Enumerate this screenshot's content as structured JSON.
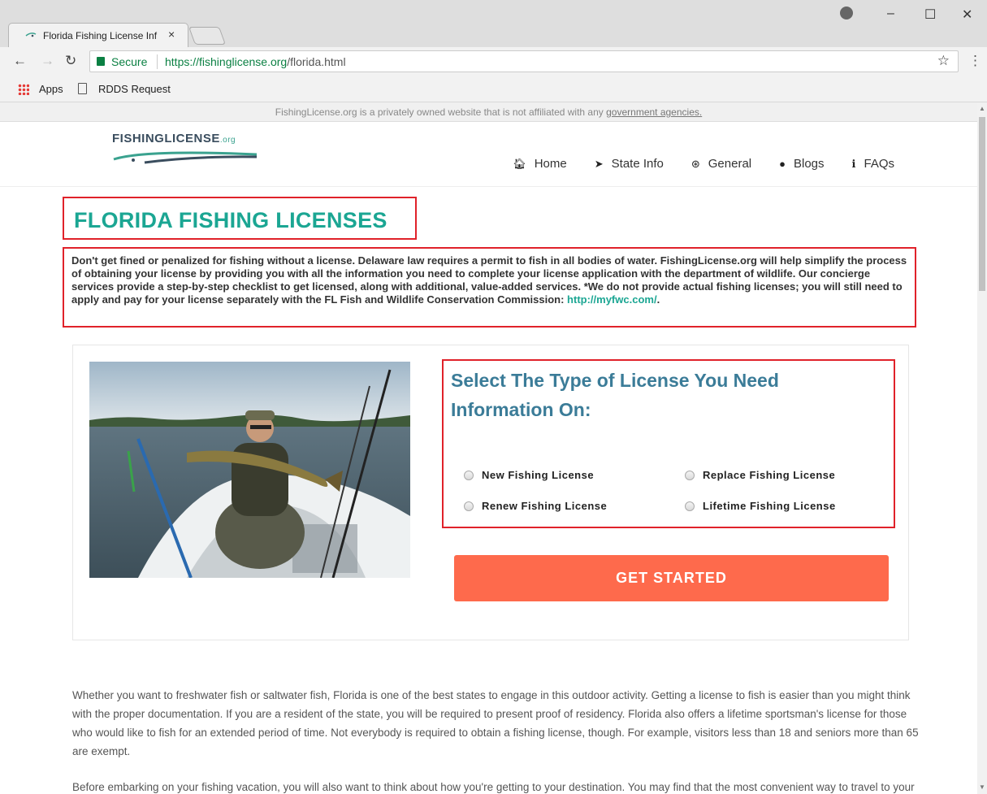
{
  "browser": {
    "tab_title": "Florida Fishing License Inf",
    "tab_close": "×",
    "secure_label": "Secure",
    "url_host": "https://fishinglicense.org",
    "url_path": "/florida.html",
    "bookmarks": [
      "Apps",
      "RDDS Request"
    ]
  },
  "disclaimer": {
    "text": "FishingLicense.org is a privately owned website that is not affiliated with any ",
    "link": "government agencies."
  },
  "logo": {
    "main": "FishingLicense",
    "suffix": ".org"
  },
  "nav": [
    {
      "icon": "home-icon",
      "label": "Home"
    },
    {
      "icon": "location-arrow-icon",
      "label": "State Info"
    },
    {
      "icon": "asterisk-icon",
      "label": "General"
    },
    {
      "icon": "comment-icon",
      "label": "Blogs"
    },
    {
      "icon": "info-icon",
      "label": "FAQs"
    }
  ],
  "page": {
    "title": "FLORIDA FISHING LICENSES",
    "intro": "Don't get fined or penalized for fishing without a license. Delaware law requires a permit to fish in all bodies of water. FishingLicense.org will help simplify the process of obtaining your license by providing you with all the information you need to complete your license application with the department of wildlife. Our concierge services provide a step-by-step checklist to get licensed, along with additional, value-added services. *We do not provide actual fishing licenses; you will still need to apply and pay for your license separately with the FL Fish and Wildlife Conservation Commission: ",
    "intro_link": "http://myfwc.com/",
    "intro_end": "."
  },
  "license_selector": {
    "title": "Select The Type of License You Need Information On:",
    "options": [
      "New Fishing License",
      "Replace Fishing License",
      "Renew Fishing License",
      "Lifetime Fishing License"
    ],
    "cta": "GET STARTED"
  },
  "body_paragraphs": [
    "Whether you want to freshwater fish or saltwater fish, Florida is one of the best states to engage in this outdoor activity. Getting a license to fish is easier than you might think with the proper documentation. If you are a resident of the state, you will be required to present proof of residency. Florida also offers a lifetime sportsman's license for those who would like to fish for an extended period of time. Not everybody is required to obtain a fishing license, though. For example, visitors less than 18 and seniors more than 65 are exempt.",
    "Before embarking on your fishing vacation, you will also want to think about how you're getting to your destination. You may find that the most convenient way to travel to your destination is by plane, by boat or by car. If you want to be well-informed about the fishing regulations in Florida, as well as brush up on"
  ],
  "colors": {
    "accent": "#1ba693",
    "cta": "#fe6a4c",
    "highlight": "#e0222a",
    "heading_blue": "#3b7c98"
  }
}
